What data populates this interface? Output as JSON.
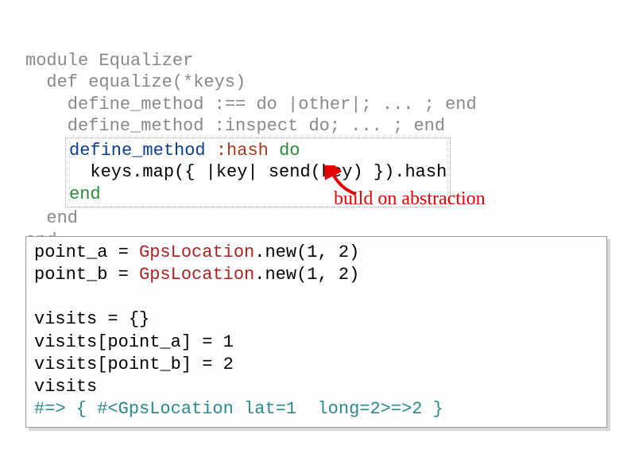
{
  "top_block": {
    "l1": "module Equalizer",
    "l2": "  def equalize(*keys)",
    "l3a": "    define_method :== do |other|; ... ; end",
    "l3b": "    define_method :inspect do; ... ; end",
    "inner": {
      "l1_pre": "define_method ",
      "l1_sym": ":hash",
      "l1_sp": " ",
      "l1_do": "do",
      "l2": "  keys.map({ |key| send(key) }).hash",
      "l3": "end"
    },
    "l5": "  end",
    "l6": "end"
  },
  "annotation": "build on abstraction",
  "snippet": {
    "l1a": "point_a = ",
    "l1b": "GpsLocation",
    "l1c": ".new(1, 2)",
    "l2a": "point_b = ",
    "l2b": "GpsLocation",
    "l2c": ".new(1, 2)",
    "blank": "",
    "l3": "visits = {}",
    "l4": "visits[point_a] = 1",
    "l5": "visits[point_b] = 2",
    "l6": "visits",
    "l7": "#=> { #<GpsLocation lat=1  long=2>=>2 }"
  }
}
